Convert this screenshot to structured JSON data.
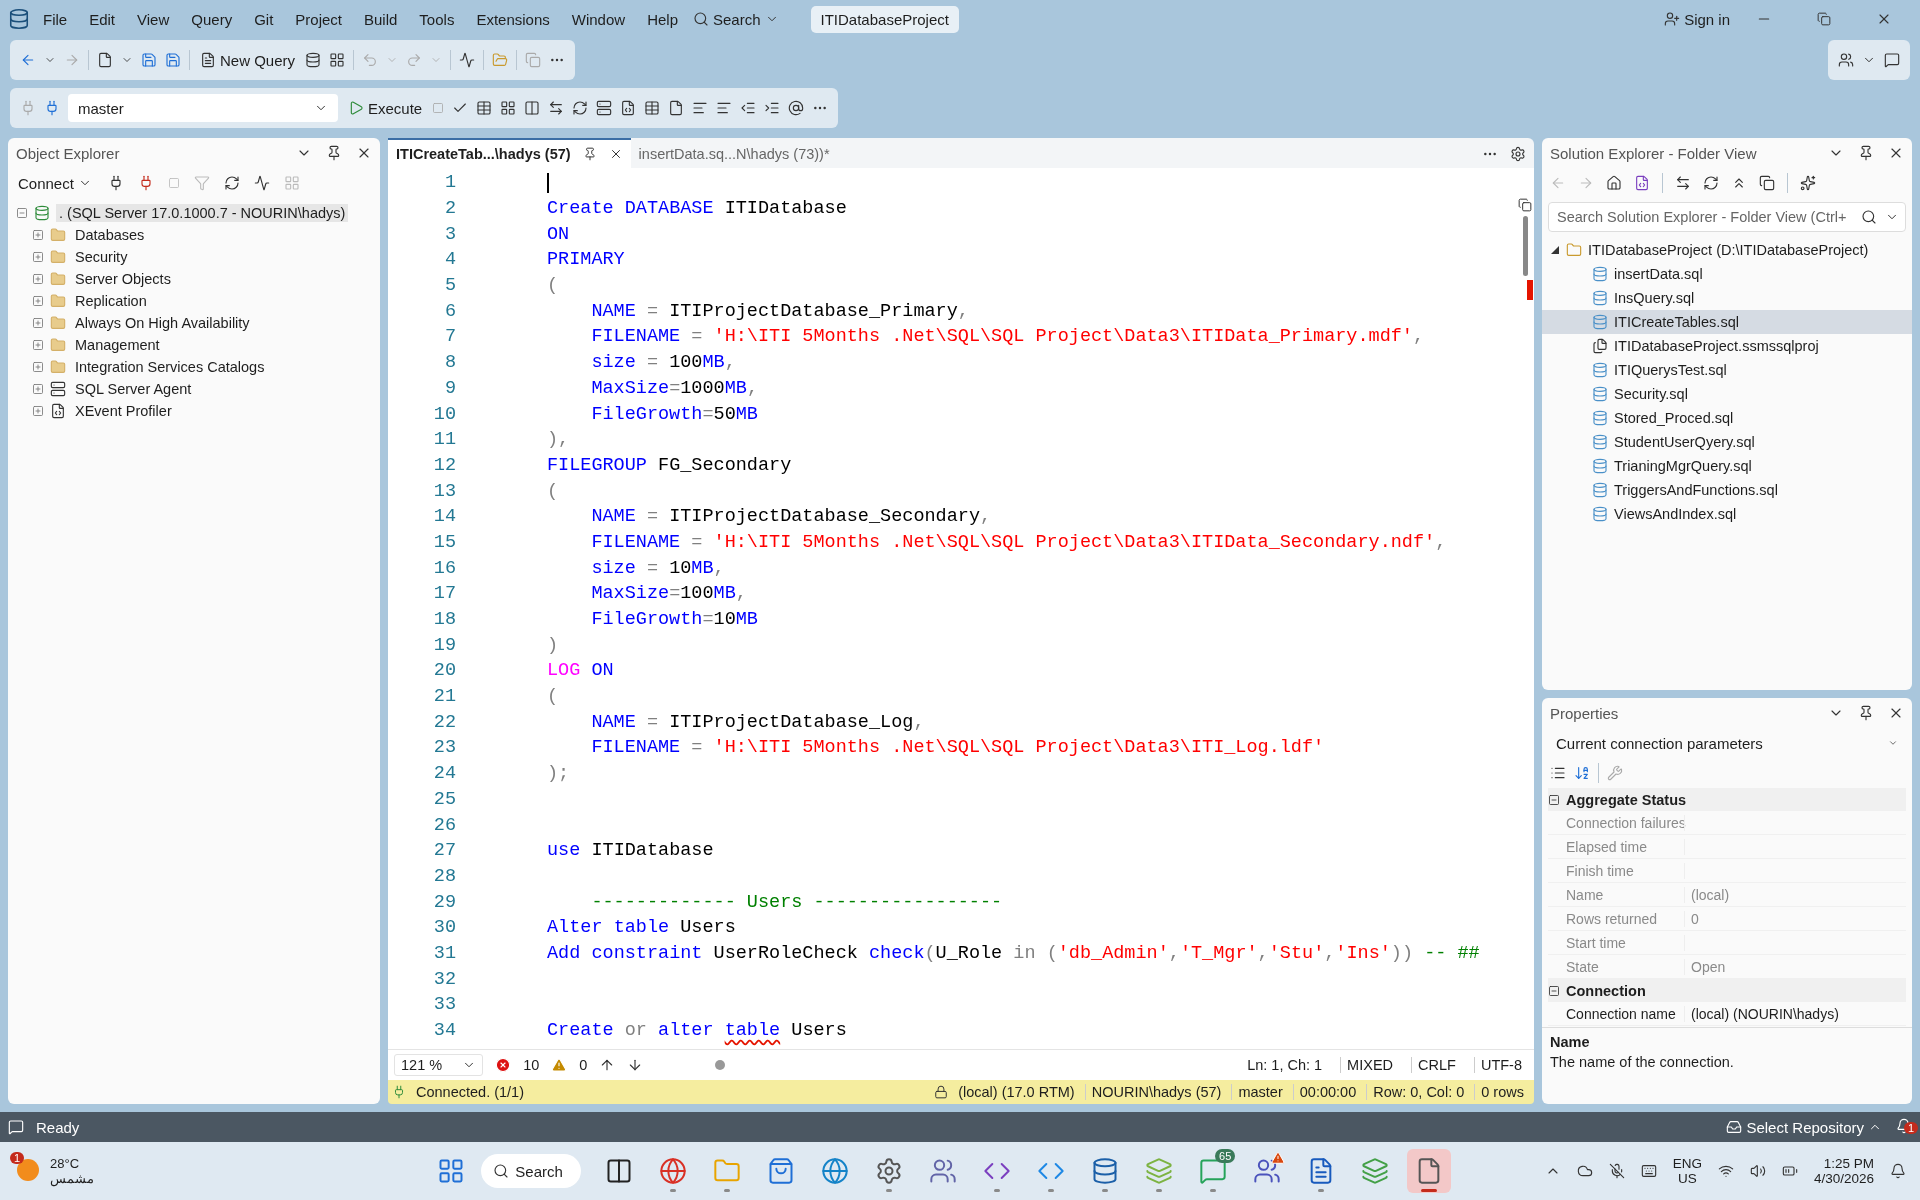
{
  "menu": [
    "File",
    "Edit",
    "View",
    "Query",
    "Git",
    "Project",
    "Build",
    "Tools",
    "Extensions",
    "Window",
    "Help"
  ],
  "menu_search": "Search",
  "project_name": "ITIDatabaseProject",
  "sign_in": "Sign in",
  "toolbar": {
    "new_query": "New Query"
  },
  "query_toolbar": {
    "database": "master",
    "execute": "Execute"
  },
  "object_explorer": {
    "title": "Object Explorer",
    "connect": "Connect",
    "server": {
      "label": ". (SQL Server 17.0.1000.7 - NOURIN\\hadys)",
      "expanded": true,
      "selected": true,
      "children": [
        {
          "label": "Databases",
          "kind": "folder",
          "expanded": false
        },
        {
          "label": "Security",
          "kind": "folder",
          "expanded": false
        },
        {
          "label": "Server Objects",
          "kind": "folder",
          "expanded": false
        },
        {
          "label": "Replication",
          "kind": "folder",
          "expanded": false
        },
        {
          "label": "Always On High Availability",
          "kind": "folder",
          "expanded": false
        },
        {
          "label": "Management",
          "kind": "folder",
          "expanded": false
        },
        {
          "label": "Integration Services Catalogs",
          "kind": "folder",
          "expanded": false
        },
        {
          "label": "SQL Server Agent",
          "kind": "agent",
          "expanded": false
        },
        {
          "label": "XEvent Profiler",
          "kind": "profiler",
          "expanded": false
        }
      ]
    }
  },
  "editor": {
    "tabs": [
      {
        "label": "ITICreateTab...\\hadys (57)",
        "selected": true
      },
      {
        "label": "insertData.sq...N\\hadys (73))*",
        "selected": false
      }
    ],
    "lines": [
      {
        "n": "1",
        "cursor": true
      },
      {
        "n": "2",
        "tokens": [
          {
            "kind": "kw",
            "t": "Create "
          },
          {
            "kind": "kw",
            "t": "DATABASE "
          },
          {
            "kind": "id",
            "t": "ITIDatabase"
          }
        ]
      },
      {
        "n": "3",
        "tokens": [
          {
            "kind": "kw",
            "t": "ON"
          }
        ]
      },
      {
        "n": "4",
        "tokens": [
          {
            "kind": "kw",
            "t": "PRIMARY"
          }
        ]
      },
      {
        "n": "5",
        "tokens": [
          {
            "kind": "op",
            "t": "("
          }
        ]
      },
      {
        "n": "6",
        "tokens": [
          {
            "kind": "kw",
            "t": "    NAME "
          },
          {
            "kind": "op",
            "t": "= "
          },
          {
            "kind": "id",
            "t": "ITIProjectDatabase_Primary"
          },
          {
            "kind": "op",
            "t": ","
          }
        ]
      },
      {
        "n": "7",
        "tokens": [
          {
            "kind": "kw",
            "t": "    FILENAME "
          },
          {
            "kind": "op",
            "t": "= "
          },
          {
            "kind": "str",
            "t": "'H:\\ITI 5Months .Net\\SQL\\SQL Project\\Data3\\ITIData_Primary.mdf'"
          },
          {
            "kind": "op",
            "t": ","
          }
        ]
      },
      {
        "n": "8",
        "tokens": [
          {
            "kind": "kw",
            "t": "    size "
          },
          {
            "kind": "op",
            "t": "= "
          },
          {
            "kind": "id",
            "t": "100"
          },
          {
            "kind": "kw",
            "t": "MB"
          },
          {
            "kind": "op",
            "t": ","
          }
        ]
      },
      {
        "n": "9",
        "tokens": [
          {
            "kind": "kw",
            "t": "    MaxSize"
          },
          {
            "kind": "op",
            "t": "="
          },
          {
            "kind": "id",
            "t": "1000"
          },
          {
            "kind": "kw",
            "t": "MB"
          },
          {
            "kind": "op",
            "t": ","
          }
        ]
      },
      {
        "n": "10",
        "tokens": [
          {
            "kind": "kw",
            "t": "    FileGrowth"
          },
          {
            "kind": "op",
            "t": "="
          },
          {
            "kind": "id",
            "t": "50"
          },
          {
            "kind": "kw",
            "t": "MB"
          }
        ]
      },
      {
        "n": "11",
        "tokens": [
          {
            "kind": "op",
            "t": "),"
          }
        ]
      },
      {
        "n": "12",
        "tokens": [
          {
            "kind": "kw",
            "t": "FILEGROUP "
          },
          {
            "kind": "id",
            "t": "FG_Secondary"
          }
        ]
      },
      {
        "n": "13",
        "tokens": [
          {
            "kind": "op",
            "t": "("
          }
        ]
      },
      {
        "n": "14",
        "tokens": [
          {
            "kind": "kw",
            "t": "    NAME "
          },
          {
            "kind": "op",
            "t": "= "
          },
          {
            "kind": "id",
            "t": "ITIProjectDatabase_Secondary"
          },
          {
            "kind": "op",
            "t": ","
          }
        ]
      },
      {
        "n": "15",
        "tokens": [
          {
            "kind": "kw",
            "t": "    FILENAME "
          },
          {
            "kind": "op",
            "t": "= "
          },
          {
            "kind": "str",
            "t": "'H:\\ITI 5Months .Net\\SQL\\SQL Project\\Data3\\ITIData_Secondary.ndf'"
          },
          {
            "kind": "op",
            "t": ","
          }
        ]
      },
      {
        "n": "16",
        "tokens": [
          {
            "kind": "kw",
            "t": "    size "
          },
          {
            "kind": "op",
            "t": "= "
          },
          {
            "kind": "id",
            "t": "10"
          },
          {
            "kind": "kw",
            "t": "MB"
          },
          {
            "kind": "op",
            "t": ","
          }
        ]
      },
      {
        "n": "17",
        "tokens": [
          {
            "kind": "kw",
            "t": "    MaxSize"
          },
          {
            "kind": "op",
            "t": "="
          },
          {
            "kind": "id",
            "t": "100"
          },
          {
            "kind": "kw",
            "t": "MB"
          },
          {
            "kind": "op",
            "t": ","
          }
        ]
      },
      {
        "n": "18",
        "tokens": [
          {
            "kind": "kw",
            "t": "    FileGrowth"
          },
          {
            "kind": "op",
            "t": "="
          },
          {
            "kind": "id",
            "t": "10"
          },
          {
            "kind": "kw",
            "t": "MB"
          }
        ]
      },
      {
        "n": "19",
        "tokens": [
          {
            "kind": "op",
            "t": ")"
          }
        ]
      },
      {
        "n": "20",
        "tokens": [
          {
            "kind": "fn",
            "t": "LOG "
          },
          {
            "kind": "kw",
            "t": "ON"
          }
        ]
      },
      {
        "n": "21",
        "tokens": [
          {
            "kind": "op",
            "t": "("
          }
        ]
      },
      {
        "n": "22",
        "tokens": [
          {
            "kind": "kw",
            "t": "    NAME "
          },
          {
            "kind": "op",
            "t": "= "
          },
          {
            "kind": "id",
            "t": "ITIProjectDatabase_Log"
          },
          {
            "kind": "op",
            "t": ","
          }
        ]
      },
      {
        "n": "23",
        "tokens": [
          {
            "kind": "kw",
            "t": "    FILENAME "
          },
          {
            "kind": "op",
            "t": "= "
          },
          {
            "kind": "str",
            "t": "'H:\\ITI 5Months .Net\\SQL\\SQL Project\\Data3\\ITI_Log.ldf'"
          }
        ]
      },
      {
        "n": "24",
        "tokens": [
          {
            "kind": "op",
            "t": ");"
          }
        ]
      },
      {
        "n": "25"
      },
      {
        "n": "26"
      },
      {
        "n": "27",
        "tokens": [
          {
            "kind": "kw",
            "t": "use "
          },
          {
            "kind": "id",
            "t": "ITIDatabase"
          }
        ]
      },
      {
        "n": "28"
      },
      {
        "n": "29",
        "tokens": [
          {
            "kind": "cmt",
            "t": "    ------------- Users -----------------"
          }
        ]
      },
      {
        "n": "30",
        "tokens": [
          {
            "kind": "kw",
            "t": "Alter "
          },
          {
            "kind": "kw",
            "t": "table "
          },
          {
            "kind": "id",
            "t": "Users"
          }
        ]
      },
      {
        "n": "31",
        "tokens": [
          {
            "kind": "kw",
            "t": "Add "
          },
          {
            "kind": "kw",
            "t": "constraint "
          },
          {
            "kind": "id",
            "t": "UserRoleCheck "
          },
          {
            "kind": "kw",
            "t": "check"
          },
          {
            "kind": "op",
            "t": "("
          },
          {
            "kind": "id",
            "t": "U_Role "
          },
          {
            "kind": "op",
            "t": "in "
          },
          {
            "kind": "op",
            "t": "("
          },
          {
            "kind": "str",
            "t": "'db_Admin'"
          },
          {
            "kind": "op",
            "t": ","
          },
          {
            "kind": "str",
            "t": "'T_Mgr'"
          },
          {
            "kind": "op",
            "t": ","
          },
          {
            "kind": "str",
            "t": "'Stu'"
          },
          {
            "kind": "op",
            "t": ","
          },
          {
            "kind": "str",
            "t": "'Ins'"
          },
          {
            "kind": "op",
            "t": ")) "
          },
          {
            "kind": "cmt",
            "t": "-- ##"
          }
        ]
      },
      {
        "n": "32"
      },
      {
        "n": "33"
      },
      {
        "n": "34",
        "tokens": [
          {
            "kind": "kw",
            "t": "Create "
          },
          {
            "kind": "op",
            "t": "or "
          },
          {
            "kind": "kw",
            "t": "alter "
          },
          {
            "kind": "kw",
            "t": "table",
            "squiggle": true
          },
          {
            "kind": "id",
            "t": " Users"
          }
        ]
      }
    ],
    "zoom": "121 %",
    "errors": "10",
    "warnings": "0",
    "position": "Ln: 1, Ch: 1",
    "whitespace": "MIXED",
    "line_ending": "CRLF",
    "encoding": "UTF-8"
  },
  "query_status": {
    "message": "Connected. (1/1)",
    "fields": [
      "(local) (17.0 RTM)",
      "NOURIN\\hadys (57)",
      "master",
      "00:00:00",
      "Row: 0, Col: 0",
      "0 rows"
    ]
  },
  "solution_explorer": {
    "title": "Solution Explorer - Folder View",
    "search_placeholder": "Search Solution Explorer - Folder View (Ctrl+",
    "root": {
      "label": "ITIDatabaseProject (D:\\ITIDatabaseProject)",
      "expanded": true,
      "children": [
        {
          "label": "insertData.sql",
          "kind": "sql",
          "selected": false
        },
        {
          "label": "InsQuery.sql",
          "kind": "sql",
          "selected": false
        },
        {
          "label": "ITICreateTables.sql",
          "kind": "sql",
          "selected": true
        },
        {
          "label": "ITIDatabaseProject.ssmssqlproj",
          "kind": "project",
          "selected": false
        },
        {
          "label": "ITIQuerysTest.sql",
          "kind": "sql",
          "selected": false
        },
        {
          "label": "Security.sql",
          "kind": "sql",
          "selected": false
        },
        {
          "label": "Stored_Proced.sql",
          "kind": "sql",
          "selected": false
        },
        {
          "label": "StudentUserQyery.sql",
          "kind": "sql",
          "selected": false
        },
        {
          "label": "TrianingMgrQuery.sql",
          "kind": "sql",
          "selected": false
        },
        {
          "label": "TriggersAndFunctions.sql",
          "kind": "sql",
          "selected": false
        },
        {
          "label": "ViewsAndIndex.sql",
          "kind": "sql",
          "selected": false
        }
      ]
    }
  },
  "properties": {
    "title": "Properties",
    "object": "Current connection parameters",
    "categories": [
      {
        "name": "Aggregate Status",
        "expanded": true,
        "rows": [
          {
            "name": "Connection failures"
          },
          {
            "name": "Elapsed time"
          },
          {
            "name": "Finish time"
          },
          {
            "name": "Name",
            "value": "(local)"
          },
          {
            "name": "Rows returned",
            "value": "0"
          },
          {
            "name": "Start time"
          },
          {
            "name": "State",
            "value": "Open"
          }
        ]
      },
      {
        "name": "Connection",
        "expanded": true,
        "rows": [
          {
            "name": "Connection name",
            "value": "(local) (NOURIN\\hadys)",
            "bright": true
          }
        ]
      }
    ],
    "description_title": "Name",
    "description": "The name of the connection."
  },
  "status_bar": {
    "text": "Ready",
    "repository": "Select Repository",
    "notifications": "1"
  },
  "taskbar": {
    "weather": {
      "badge": "1",
      "temperature": "28°C",
      "condition": "مشمس"
    },
    "search": "Search",
    "apps": [
      {
        "kind": "taskview",
        "running": false,
        "selected": false
      },
      {
        "kind": "chrome",
        "running": true,
        "selected": false
      },
      {
        "kind": "files",
        "running": true,
        "selected": false
      },
      {
        "kind": "store",
        "running": false,
        "selected": false
      },
      {
        "kind": "edge",
        "running": false,
        "selected": false
      },
      {
        "kind": "settings",
        "running": true,
        "selected": false
      },
      {
        "kind": "teams",
        "running": false,
        "selected": false
      },
      {
        "kind": "vs",
        "running": true,
        "selected": false
      },
      {
        "kind": "vscode",
        "running": true,
        "selected": false
      },
      {
        "kind": "ssms",
        "running": true,
        "selected": false
      },
      {
        "kind": "bluestacks",
        "running": true,
        "selected": false
      },
      {
        "kind": "whatsapp",
        "running": true,
        "selected": false,
        "badge": "65"
      },
      {
        "kind": "teams2",
        "running": false,
        "selected": false,
        "alert": true
      },
      {
        "kind": "word",
        "running": true,
        "selected": false
      },
      {
        "kind": "layers",
        "running": false,
        "selected": false
      },
      {
        "kind": "notepad",
        "running": true,
        "selected": true
      }
    ],
    "language": "ENG",
    "region": "US",
    "time": "1:25 PM",
    "date": "4/30/2026"
  }
}
